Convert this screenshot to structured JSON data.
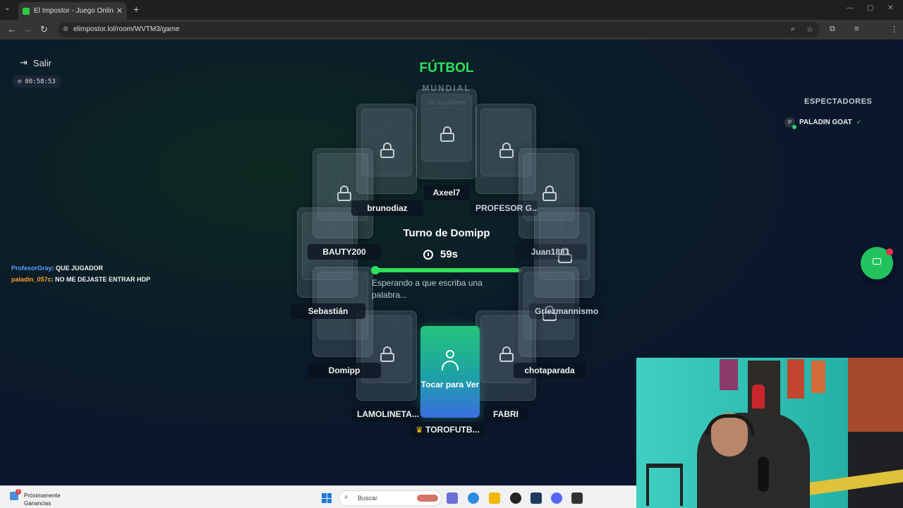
{
  "browser": {
    "tab_title": "El Impostor - Juego Online Gra",
    "url": "elimpostor.lol/room/WVTM3/game",
    "profile_initial": "M"
  },
  "header": {
    "exit_label": "Salir",
    "elapsed_time": "00:58:53",
    "category": "FÚTBOL",
    "subcategory": "MUNDIAL",
    "player_count": "13 Jugadores"
  },
  "spectators": {
    "title": "ESPECTADORES",
    "users": [
      {
        "initial": "P",
        "name": "PALADIN GOAT"
      }
    ]
  },
  "chat": [
    {
      "user": "ProfesorGray",
      "message": ": QUE JUGADOR"
    },
    {
      "user": "paladin_057c",
      "message": ": NO ME DEJASTE ENTRAR HDP"
    }
  ],
  "players": [
    {
      "name": "Axeel7"
    },
    {
      "name": "PROFESOR G..."
    },
    {
      "name": "Juan1881"
    },
    {
      "name": "Griezmannismo"
    },
    {
      "name": "chotaparada"
    },
    {
      "name": "FABRI"
    },
    {
      "name": "TOROFUTB..."
    },
    {
      "name": "LAMOLINETA..."
    },
    {
      "name": "Domipp"
    },
    {
      "name": "Sebastián"
    },
    {
      "name": "BAUTY200"
    },
    {
      "name": "brunodiaz"
    }
  ],
  "host_crown": "♛",
  "my_card": {
    "label": "Tocar para Ver"
  },
  "turn": {
    "title": "Turno de Domipp",
    "seconds_left": "59s",
    "progress_fraction": 0.98,
    "status": "Esperando a que escriba una palabra..."
  },
  "taskbar": {
    "weather_line1": "Próximamente",
    "weather_line2": "Ganancias",
    "weather_badge": "2",
    "search_placeholder": "Buscar"
  },
  "colors": {
    "accent_green": "#2fe05a",
    "card_gradient_top": "#24c37a",
    "card_gradient_bottom": "#3a6ee0",
    "chat_user1": "#5aa0ff",
    "chat_user2": "#ff9b2e"
  }
}
